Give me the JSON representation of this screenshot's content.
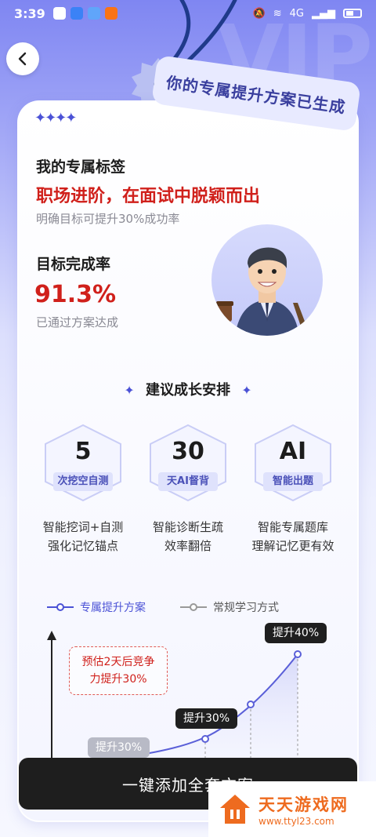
{
  "status_bar": {
    "time": "3:39",
    "network": "4G"
  },
  "banner": {
    "text": "你的专属提升方案已生成"
  },
  "decor": {
    "stars": "✦✦✦✦"
  },
  "tag": {
    "title": "我的专属标签",
    "headline": "职场进阶，在面试中脱颖而出",
    "subtitle": "明确目标可提升30%成功率"
  },
  "goal": {
    "title": "目标完成率",
    "value": "91.3%",
    "subtitle": "已通过方案达成"
  },
  "growth": {
    "title": "建议成长安排",
    "items": [
      {
        "number": "5",
        "unit": "次挖空自测",
        "desc_line1": "智能挖词+自测",
        "desc_line2": "强化记忆锚点"
      },
      {
        "number": "30",
        "unit": "天AI督背",
        "desc_line1": "智能诊断生疏",
        "desc_line2": "效率翻倍"
      },
      {
        "number": "AI",
        "unit": "智能出题",
        "desc_line1": "智能专属题库",
        "desc_line2": "理解记忆更有效"
      }
    ]
  },
  "chart": {
    "legend": {
      "primary": "专属提升方案",
      "secondary": "常规学习方式"
    },
    "estimate_line1": "预估2天后竞争",
    "estimate_line2": "力提升30%",
    "bubbles": {
      "low": "提升30%",
      "mid": "提升30%",
      "high": "提升40%"
    }
  },
  "cta": {
    "label": "一键添加全套方案"
  },
  "watermark": {
    "name": "天天游戏网",
    "url": "www.ttyl23.com"
  },
  "colors": {
    "accent": "#4b52d6",
    "highlight": "#d0201b",
    "button": "#1e1e1e"
  }
}
